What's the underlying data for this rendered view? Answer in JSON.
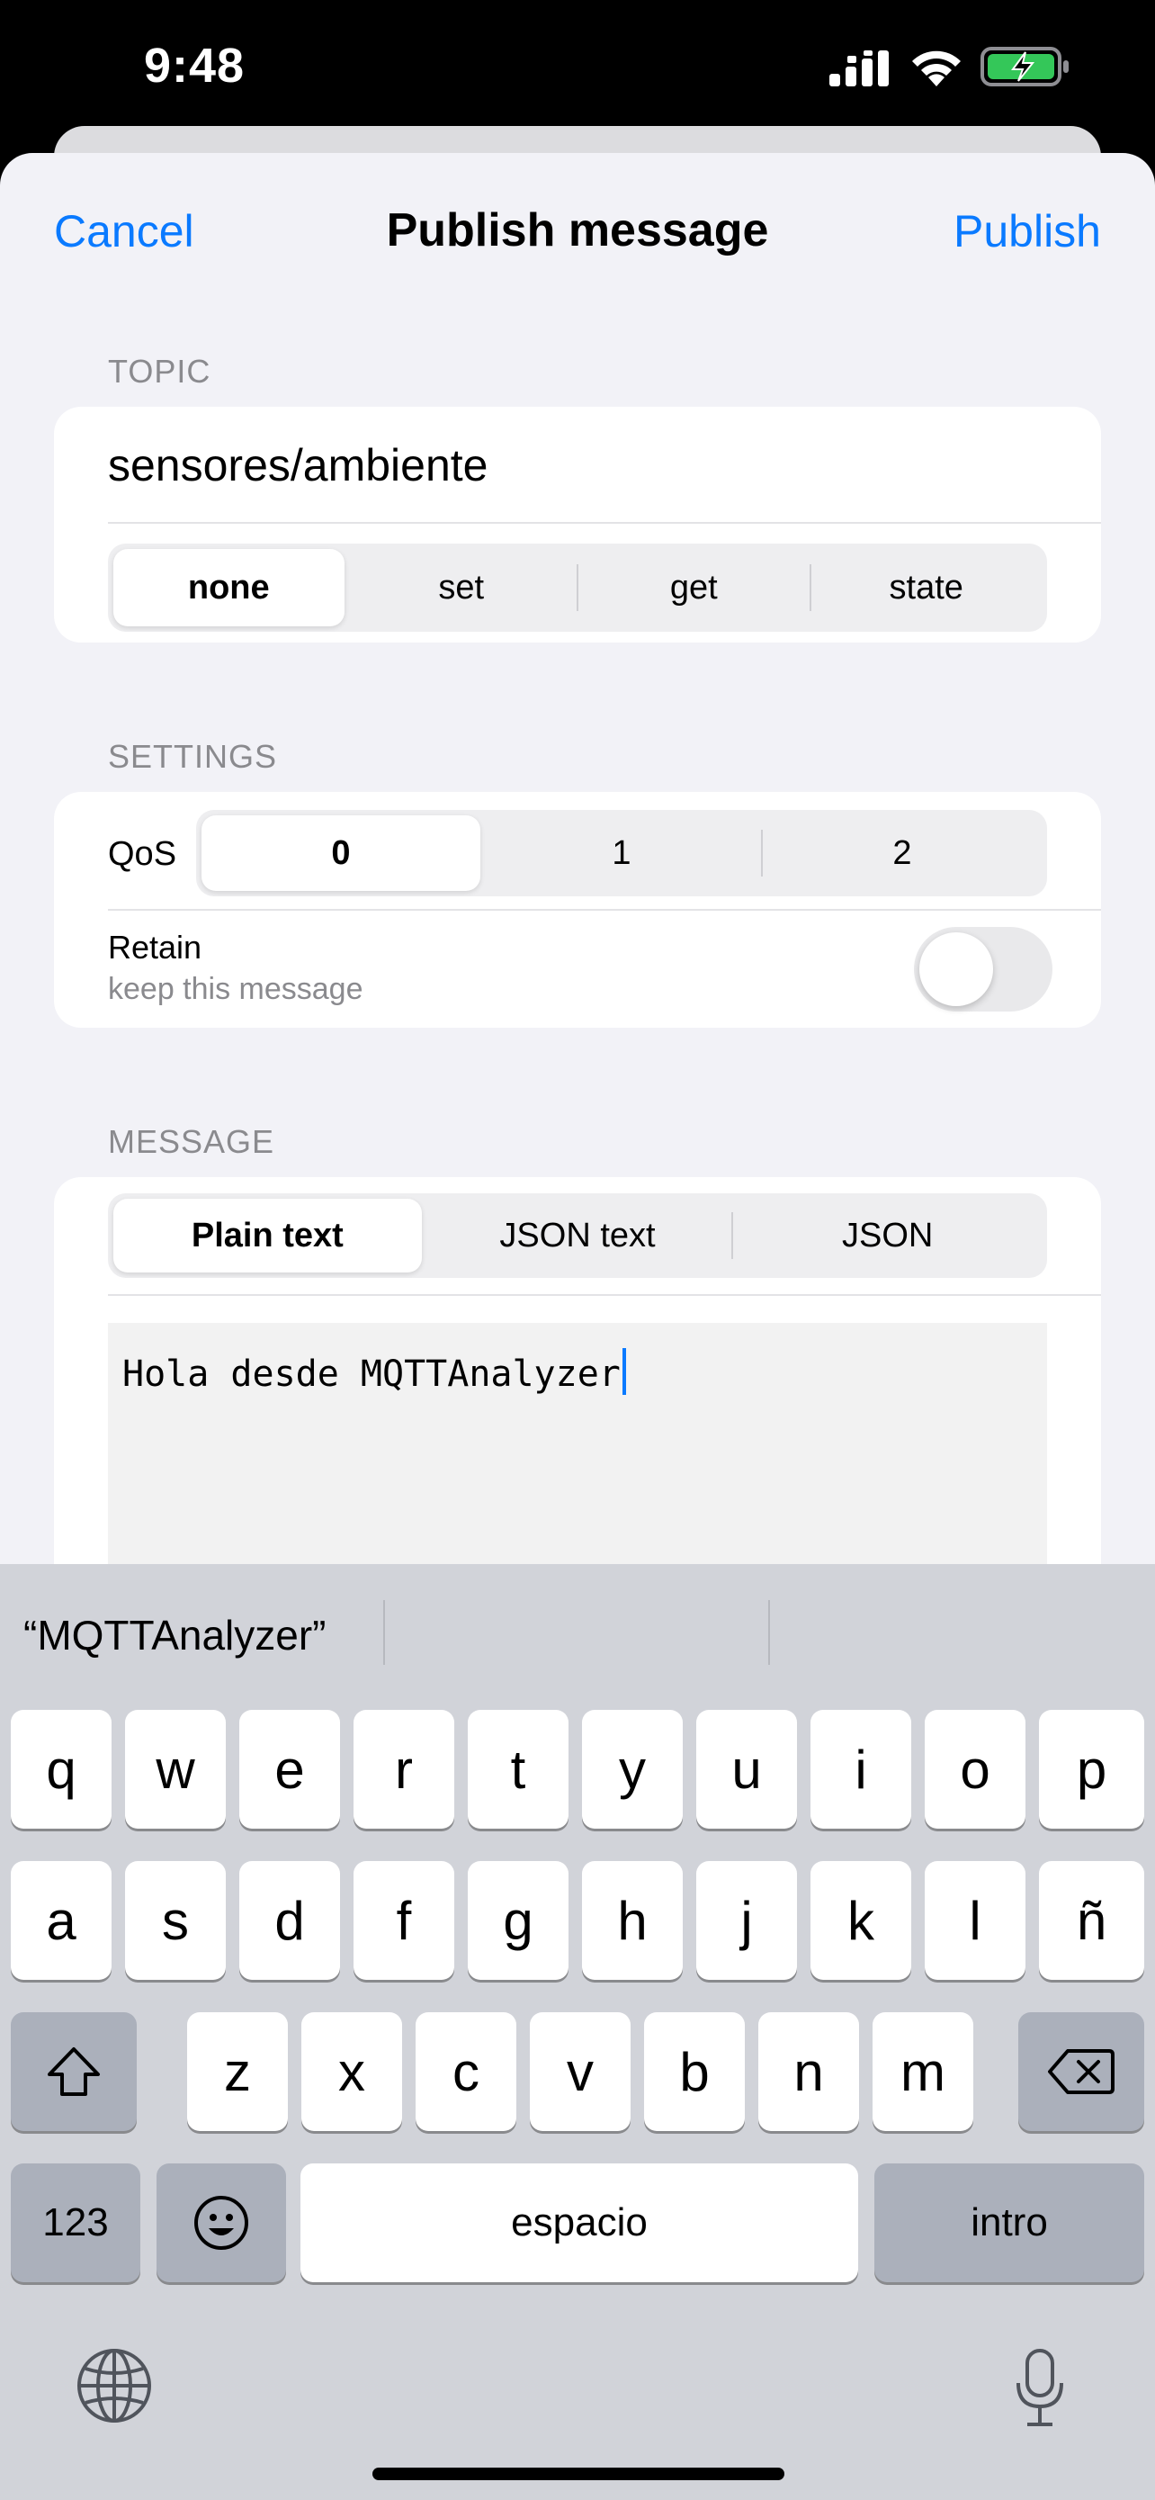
{
  "status_bar": {
    "time": "9:48"
  },
  "nav": {
    "cancel_label": "Cancel",
    "title": "Publish message",
    "publish_label": "Publish"
  },
  "topic": {
    "header": "TOPIC",
    "value": "sensores/ambiente",
    "suffix_options": [
      "none",
      "set",
      "get",
      "state"
    ],
    "selected_suffix": "none"
  },
  "settings": {
    "header": "SETTINGS",
    "qos_label": "QoS",
    "qos_options": [
      "0",
      "1",
      "2"
    ],
    "qos_selected": "0",
    "retain_label": "Retain",
    "retain_sub": "keep this message",
    "retain_on": false
  },
  "message": {
    "header": "MESSAGE",
    "format_options": [
      "Plain text",
      "JSON text",
      "JSON"
    ],
    "format_selected": "Plain text",
    "body": "Hola desde MQTTAnalyzer"
  },
  "keyboard": {
    "suggestion": "“MQTTAnalyzer”",
    "row1": [
      "q",
      "w",
      "e",
      "r",
      "t",
      "y",
      "u",
      "i",
      "o",
      "p"
    ],
    "row2": [
      "a",
      "s",
      "d",
      "f",
      "g",
      "h",
      "j",
      "k",
      "l",
      "ñ"
    ],
    "row3": [
      "z",
      "x",
      "c",
      "v",
      "b",
      "n",
      "m"
    ],
    "numbers_label": "123",
    "space_label": "espacio",
    "return_label": "intro"
  },
  "colors": {
    "accent": "#0a7aff",
    "background": "#f2f2f7",
    "keyboard": "#d1d3d9"
  }
}
